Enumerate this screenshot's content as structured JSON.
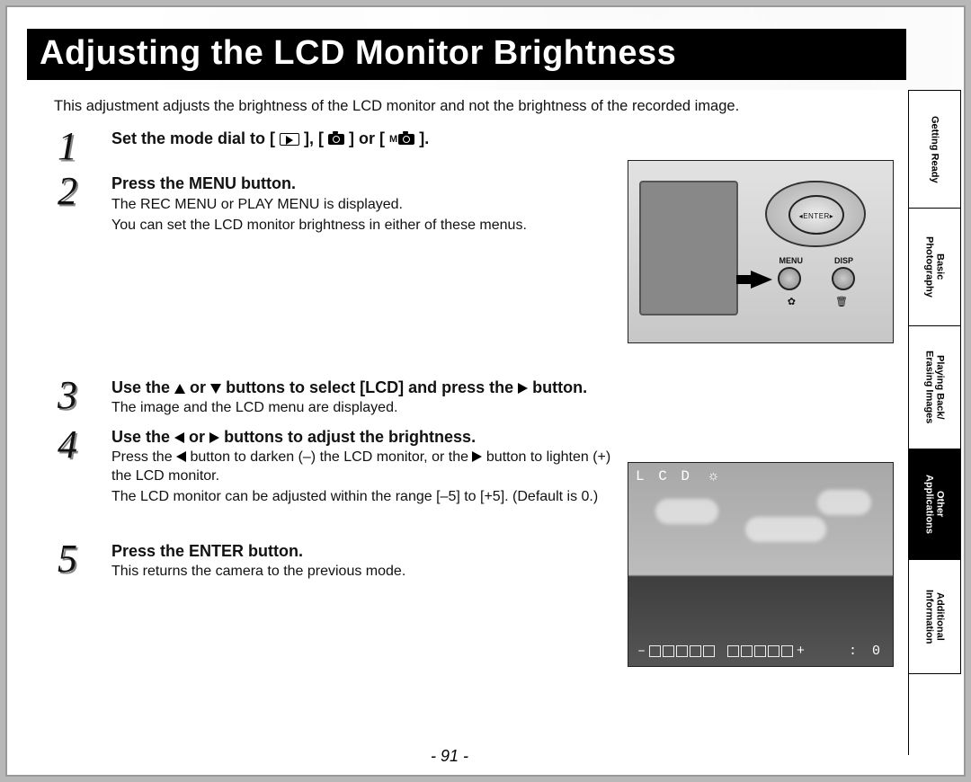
{
  "header": {
    "title": "Adjusting the LCD Monitor Brightness"
  },
  "intro": "This adjustment adjusts the brightness of the LCD monitor and not the brightness of the recorded image.",
  "steps": {
    "s1": {
      "head_pre": "Set the mode dial to  [ ",
      "head_mid1": " ], [ ",
      "head_mid2": " ] or [ ",
      "head_post": " ]."
    },
    "s2": {
      "head": "Press the MENU button.",
      "body1": "The REC MENU or PLAY MENU is displayed.",
      "body2": "You can set the LCD monitor brightness in either of these menus."
    },
    "s3": {
      "head_pre": "Use the ",
      "head_mid": " or ",
      "head_mid2": " buttons to select [LCD] and press the ",
      "head_post": " button.",
      "body": "The image and the LCD menu are displayed."
    },
    "s4": {
      "head_pre": "Use the ",
      "head_mid": " or ",
      "head_post": " buttons to adjust the brightness.",
      "body_pre": "Press the ",
      "body_mid1": " button to darken (–) the LCD monitor, or the ",
      "body_mid2": " button to lighten (+) the LCD monitor.",
      "body2": "The LCD monitor can be adjusted within the range [–5] to [+5]. (Default is 0.)"
    },
    "s5": {
      "head": "Press the ENTER button.",
      "body": "This returns the camera to the previous mode."
    }
  },
  "camera": {
    "enter": "◂ENTER▸",
    "menu": "MENU",
    "disp": "DISP"
  },
  "lcd": {
    "label": "L C D",
    "minus": "–",
    "plus": "+",
    "value": ":   0"
  },
  "tabs": {
    "t1a": "Getting Ready",
    "t2a": "Basic",
    "t2b": "Photography",
    "t3a": "Playing Back/",
    "t3b": "Erasing Images",
    "t4a": "Other",
    "t4b": "Applications",
    "t5a": "Additional",
    "t5b": "Information"
  },
  "page": "- 91 -"
}
